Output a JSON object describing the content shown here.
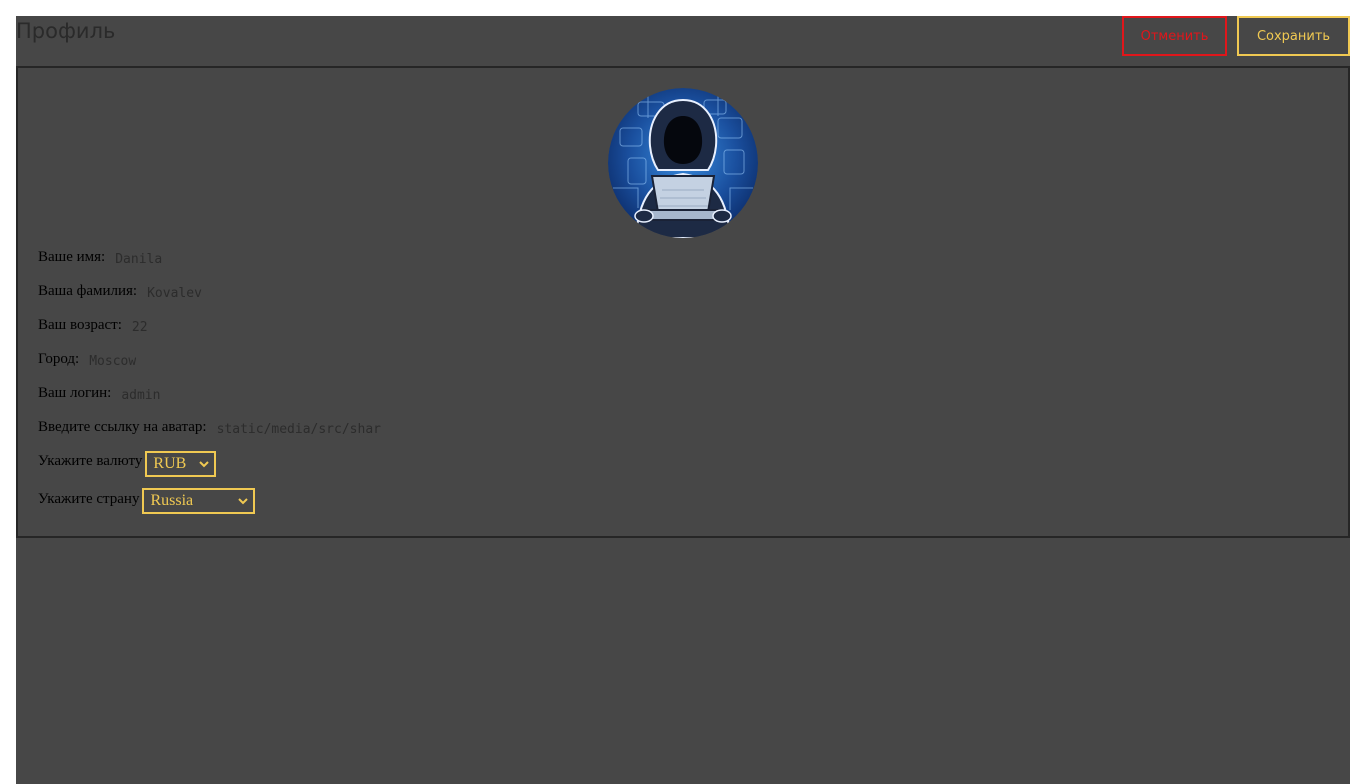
{
  "header": {
    "title": "Профиль",
    "cancel_label": "Отменить",
    "save_label": "Сохранить"
  },
  "colors": {
    "background": "#474747",
    "cancel": "#e0161b",
    "accent": "#f0c952"
  },
  "profile": {
    "avatar_icon": "hooded-hacker-avatar",
    "first_name_label": "Ваше имя:",
    "first_name": "Danila",
    "last_name_label": "Ваша фамилия:",
    "last_name": "Kovalev",
    "age_label": "Ваш возраст:",
    "age": "22",
    "city_label": "Город:",
    "city": "Moscow",
    "login_label": "Ваш логин:",
    "login": "admin",
    "avatar_link_label": "Введите ссылку на аватар:",
    "avatar_link": "static/media/src/shar",
    "currency_label": "Укажите валюту",
    "currency": "RUB",
    "country_label": "Укажите страну",
    "country": "Russia"
  }
}
